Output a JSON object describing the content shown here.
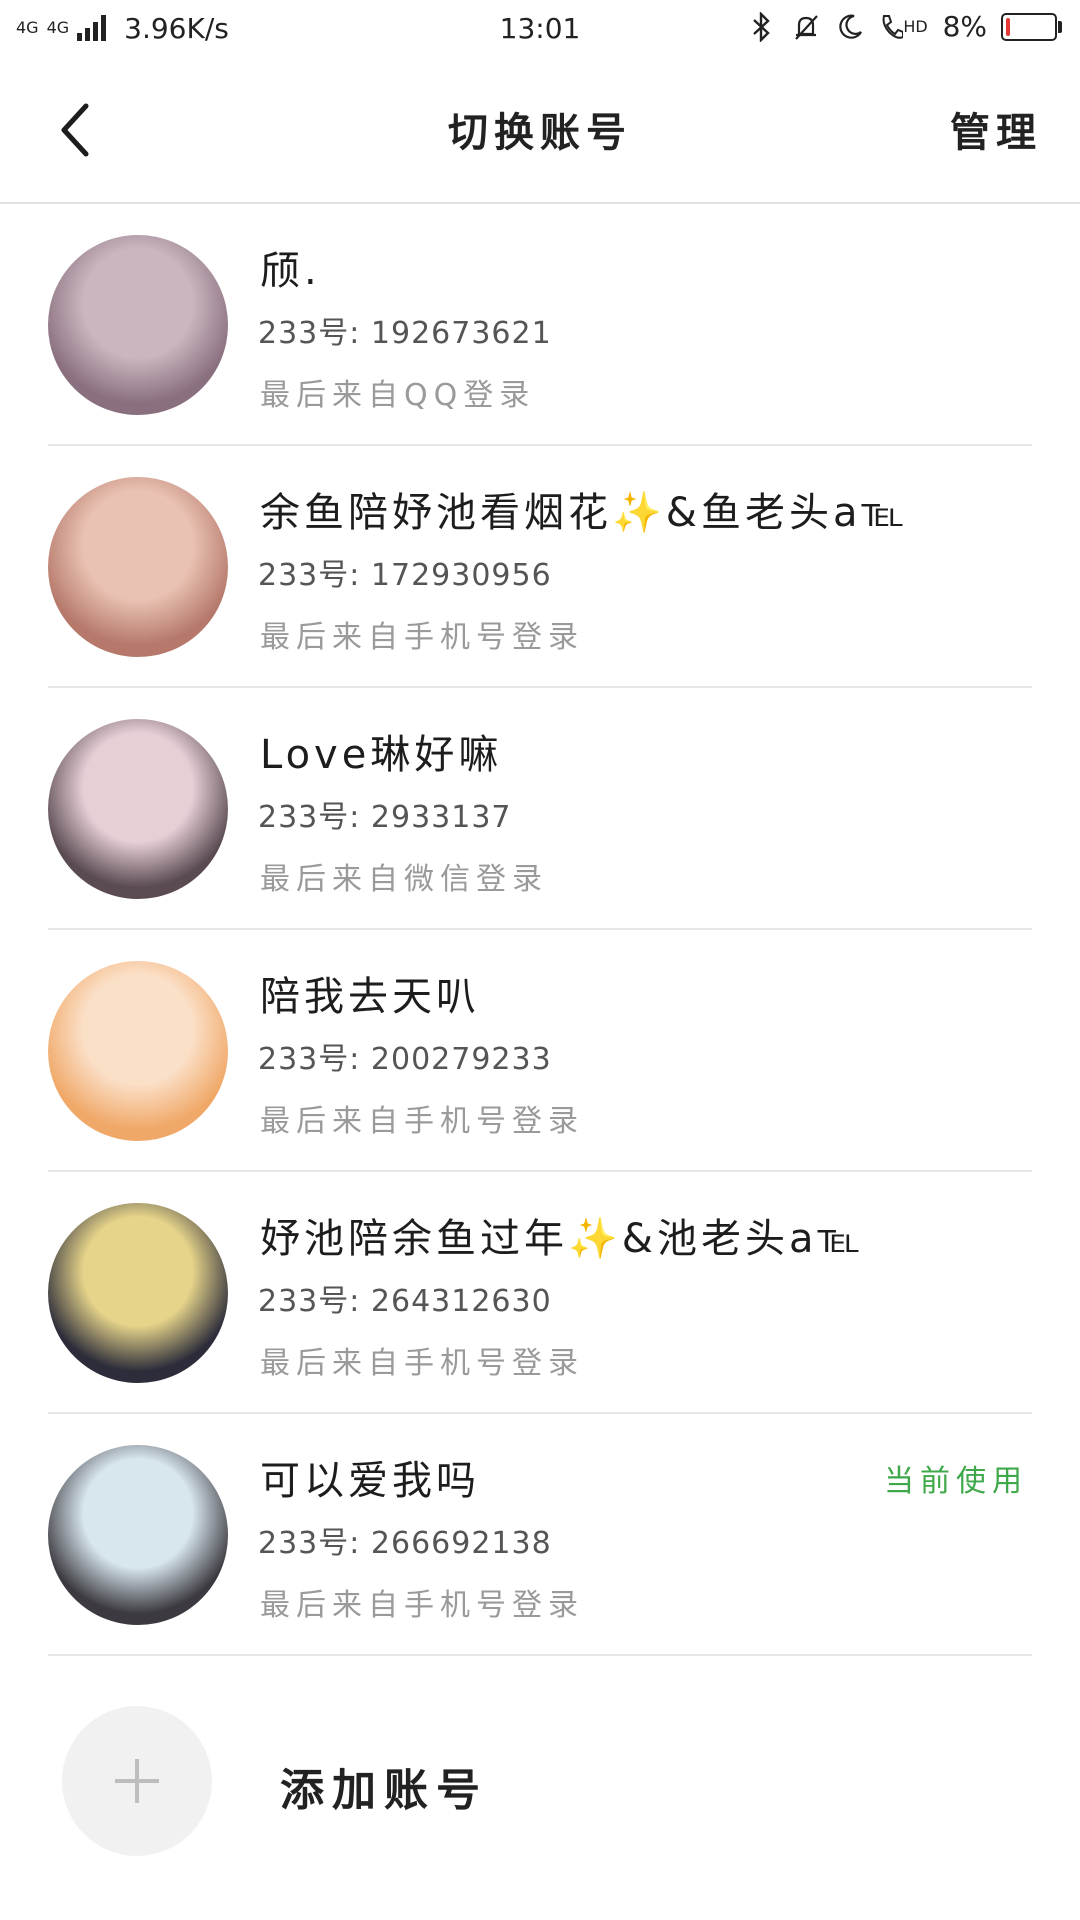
{
  "status_bar": {
    "network": "4G",
    "network2": "4G",
    "speed": "3.96K/s",
    "time": "13:01",
    "hd": "HD",
    "battery_pct": "8%",
    "battery_level": 0.08,
    "battery_color": "#e53935"
  },
  "header": {
    "back_icon": "chevron-left-icon",
    "title": "切换账号",
    "manage_label": "管理"
  },
  "accounts": [
    {
      "nickname": "颀.",
      "uid": "233号: 192673621",
      "login_from": "最后来自QQ登录",
      "current": "",
      "avatar_colors": [
        "#8a6f7e",
        "#c9b6c0"
      ]
    },
    {
      "nickname": "余鱼陪妤池看烟花✨&鱼老头a℡",
      "uid": "233号: 172930956",
      "login_from": "最后来自手机号登录",
      "current": "",
      "avatar_colors": [
        "#b5786a",
        "#e9c2b3"
      ]
    },
    {
      "nickname": "Love琳好嘛",
      "uid": "233号: 2933137",
      "login_from": "最后来自微信登录",
      "current": "",
      "avatar_colors": [
        "#5a4a52",
        "#e7cfd6"
      ]
    },
    {
      "nickname": "陪我去天叭",
      "uid": "233号: 200279233",
      "login_from": "最后来自手机号登录",
      "current": "",
      "avatar_colors": [
        "#f0a868",
        "#fbe0c8"
      ]
    },
    {
      "nickname": "妤池陪余鱼过年✨&池老头a℡",
      "uid": "233号: 264312630",
      "login_from": "最后来自手机号登录",
      "current": "",
      "avatar_colors": [
        "#2c2c3a",
        "#e6d48a"
      ]
    },
    {
      "nickname": "可以爱我吗",
      "uid": "233号: 266692138",
      "login_from": "最后来自手机号登录",
      "current": "当前使用",
      "avatar_colors": [
        "#3c3a40",
        "#d8e6ee"
      ]
    }
  ],
  "add_account": {
    "icon": "plus-icon",
    "label": "添加账号"
  },
  "accent_current": "#3fa84a"
}
